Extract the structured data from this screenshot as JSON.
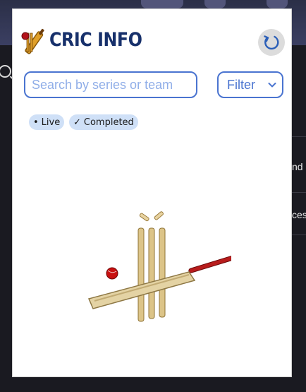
{
  "app": {
    "brand_name": "CRIC INFO",
    "logo_icon": "cricket-bat-ball-logo-icon",
    "accent_color": "#4a74d0",
    "brand_color": "#17306b"
  },
  "header": {
    "refresh_icon": "refresh-icon"
  },
  "search": {
    "placeholder": "Search by series or team",
    "value": ""
  },
  "filter": {
    "selected": "Filter",
    "caret_icon": "chevron-down-icon"
  },
  "chips": [
    {
      "mark": "•",
      "label": "Live"
    },
    {
      "mark": "✓",
      "label": "Completed"
    }
  ],
  "illustration": {
    "icon": "cricket-stumps-bat-ball-icon"
  },
  "background": {
    "row_1_text": "nd",
    "row_2_text": "ces"
  }
}
